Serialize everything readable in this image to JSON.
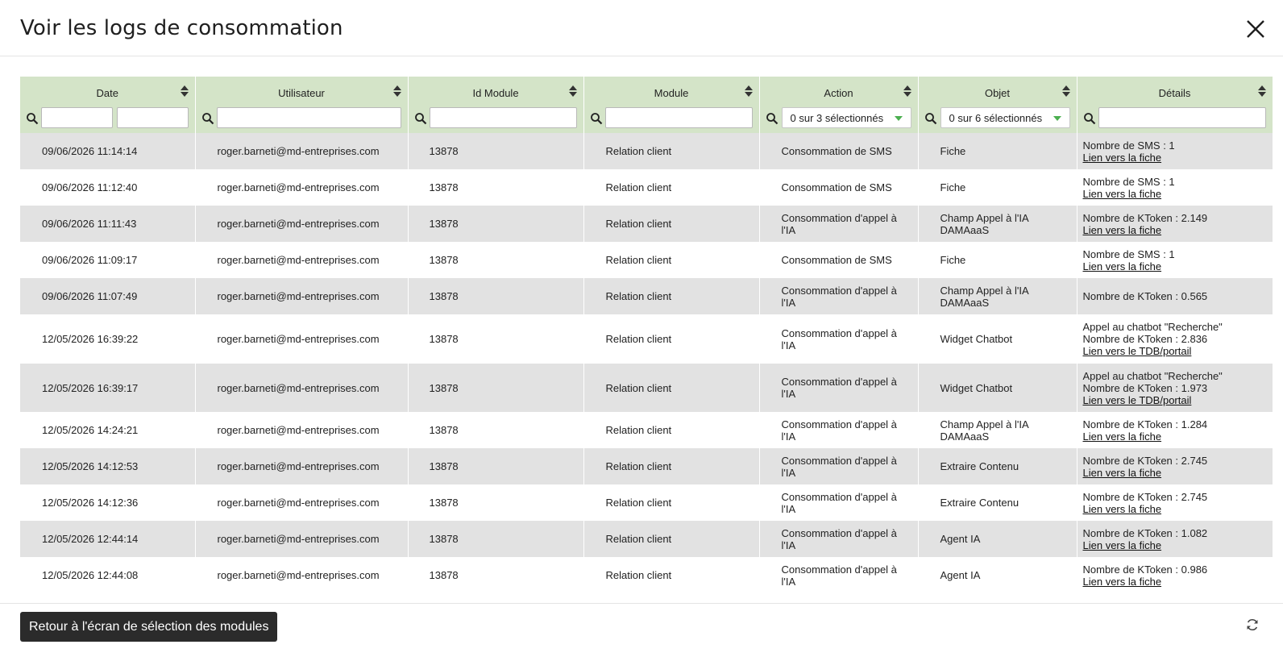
{
  "modal": {
    "title": "Voir les logs de consommation"
  },
  "table": {
    "columns": [
      {
        "label": "Date",
        "filter": "date-range"
      },
      {
        "label": "Utilisateur",
        "filter": "text"
      },
      {
        "label": "Id Module",
        "filter": "text"
      },
      {
        "label": "Module",
        "filter": "text"
      },
      {
        "label": "Action",
        "filter": "select",
        "selected": "0 sur 3 sélectionnés"
      },
      {
        "label": "Objet",
        "filter": "select",
        "selected": "0 sur 6 sélectionnés"
      },
      {
        "label": "Détails",
        "filter": "text"
      }
    ],
    "rows": [
      {
        "date": "09/06/2026 11:14:14",
        "user": "roger.barneti@md-entreprises.com",
        "id_module": "13878",
        "module": "Relation client",
        "action": "Consommation de SMS",
        "objet": "Fiche",
        "details": [
          "Nombre de SMS : 1"
        ],
        "link": "Lien vers la fiche"
      },
      {
        "date": "09/06/2026 11:12:40",
        "user": "roger.barneti@md-entreprises.com",
        "id_module": "13878",
        "module": "Relation client",
        "action": "Consommation de SMS",
        "objet": "Fiche",
        "details": [
          "Nombre de SMS : 1"
        ],
        "link": "Lien vers la fiche"
      },
      {
        "date": "09/06/2026 11:11:43",
        "user": "roger.barneti@md-entreprises.com",
        "id_module": "13878",
        "module": "Relation client",
        "action": "Consommation d'appel à l'IA",
        "objet": "Champ Appel à l'IA DAMAaaS",
        "details": [
          "Nombre de KToken : 2.149"
        ],
        "link": "Lien vers la fiche"
      },
      {
        "date": "09/06/2026 11:09:17",
        "user": "roger.barneti@md-entreprises.com",
        "id_module": "13878",
        "module": "Relation client",
        "action": "Consommation de SMS",
        "objet": "Fiche",
        "details": [
          "Nombre de SMS : 1"
        ],
        "link": "Lien vers la fiche"
      },
      {
        "date": "09/06/2026 11:07:49",
        "user": "roger.barneti@md-entreprises.com",
        "id_module": "13878",
        "module": "Relation client",
        "action": "Consommation d'appel à l'IA",
        "objet": "Champ Appel à l'IA DAMAaaS",
        "details": [
          "Nombre de KToken : 0.565"
        ],
        "link": ""
      },
      {
        "date": "12/05/2026 16:39:22",
        "user": "roger.barneti@md-entreprises.com",
        "id_module": "13878",
        "module": "Relation client",
        "action": "Consommation d'appel à l'IA",
        "objet": "Widget Chatbot",
        "details": [
          "Appel au chatbot \"Recherche\"",
          "Nombre de KToken : 2.836"
        ],
        "link": "Lien vers le TDB/portail"
      },
      {
        "date": "12/05/2026 16:39:17",
        "user": "roger.barneti@md-entreprises.com",
        "id_module": "13878",
        "module": "Relation client",
        "action": "Consommation d'appel à l'IA",
        "objet": "Widget Chatbot",
        "details": [
          "Appel au chatbot \"Recherche\"",
          "Nombre de KToken : 1.973"
        ],
        "link": "Lien vers le TDB/portail"
      },
      {
        "date": "12/05/2026 14:24:21",
        "user": "roger.barneti@md-entreprises.com",
        "id_module": "13878",
        "module": "Relation client",
        "action": "Consommation d'appel à l'IA",
        "objet": "Champ Appel à l'IA DAMAaaS",
        "details": [
          "Nombre de KToken : 1.284"
        ],
        "link": "Lien vers la fiche"
      },
      {
        "date": "12/05/2026 14:12:53",
        "user": "roger.barneti@md-entreprises.com",
        "id_module": "13878",
        "module": "Relation client",
        "action": "Consommation d'appel à l'IA",
        "objet": "Extraire Contenu",
        "details": [
          "Nombre de KToken : 2.745"
        ],
        "link": "Lien vers la fiche"
      },
      {
        "date": "12/05/2026 14:12:36",
        "user": "roger.barneti@md-entreprises.com",
        "id_module": "13878",
        "module": "Relation client",
        "action": "Consommation d'appel à l'IA",
        "objet": "Extraire Contenu",
        "details": [
          "Nombre de KToken : 2.745"
        ],
        "link": "Lien vers la fiche"
      },
      {
        "date": "12/05/2026 12:44:14",
        "user": "roger.barneti@md-entreprises.com",
        "id_module": "13878",
        "module": "Relation client",
        "action": "Consommation d'appel à l'IA",
        "objet": "Agent IA",
        "details": [
          "Nombre de KToken : 1.082"
        ],
        "link": "Lien vers la fiche"
      },
      {
        "date": "12/05/2026 12:44:08",
        "user": "roger.barneti@md-entreprises.com",
        "id_module": "13878",
        "module": "Relation client",
        "action": "Consommation d'appel à l'IA",
        "objet": "Agent IA",
        "details": [
          "Nombre de KToken : 0.986"
        ],
        "link": "Lien vers la fiche"
      }
    ]
  },
  "footer": {
    "back_label": "Retour à l'écran de sélection des modules"
  },
  "icons": {
    "close": "close-icon",
    "sort": "sort-icon",
    "search": "search-icon",
    "refresh": "refresh-icon",
    "caret": "chevron-down-icon"
  },
  "colors": {
    "header_bg": "#d4e4c8",
    "row_alt": "#e2e2e2",
    "caret": "#4caf50",
    "button_bg": "#2b2b2b"
  }
}
